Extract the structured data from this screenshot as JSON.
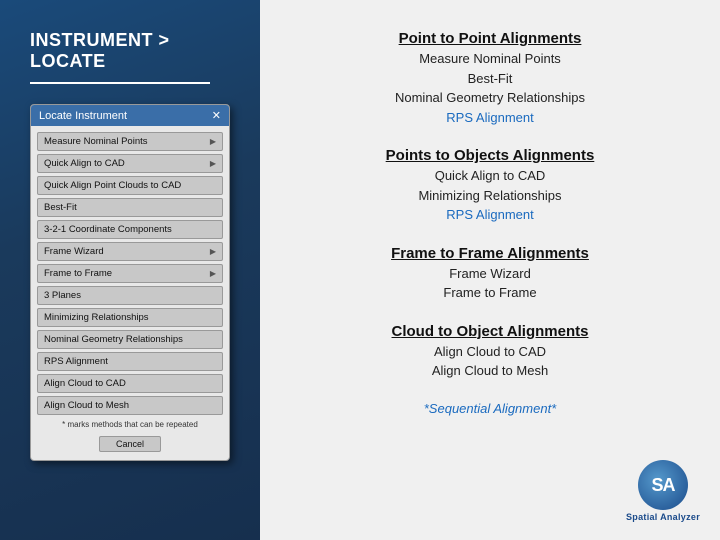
{
  "left": {
    "title": "INSTRUMENT > LOCATE",
    "dialog": {
      "title": "Locate Instrument",
      "buttons": [
        {
          "label": "Measure Nominal Points",
          "arrow": true
        },
        {
          "label": "Quick Align to CAD",
          "arrow": true
        },
        {
          "label": "Quick Align Point Clouds to CAD",
          "arrow": false
        },
        {
          "label": "Best-Fit",
          "arrow": false
        },
        {
          "label": "3-2-1 Coordinate Components",
          "arrow": false
        },
        {
          "label": "Frame Wizard",
          "arrow": true
        },
        {
          "label": "Frame to Frame",
          "arrow": true
        },
        {
          "label": "3 Planes",
          "arrow": false
        },
        {
          "label": "Minimizing Relationships",
          "arrow": false
        },
        {
          "label": "Nominal Geometry Relationships",
          "arrow": false
        },
        {
          "label": "RPS Alignment",
          "arrow": false
        },
        {
          "label": "Align Cloud to CAD",
          "arrow": false
        },
        {
          "label": "Align Cloud to Mesh",
          "arrow": false
        }
      ],
      "footer": "* marks methods that can be repeated",
      "cancel": "Cancel"
    }
  },
  "right": {
    "sections": [
      {
        "heading": "Point to Point Alignments",
        "items": [
          "Measure Nominal Points",
          "Best-Fit",
          "Nominal Geometry Relationships"
        ],
        "highlight": "RPS Alignment"
      },
      {
        "heading": "Points to Objects Alignments",
        "items": [
          "Quick Align to CAD",
          "Minimizing Relationships"
        ],
        "highlight": "RPS Alignment"
      },
      {
        "heading": "Frame to Frame Alignments",
        "items": [
          "Frame Wizard",
          "Frame to Frame"
        ],
        "highlight": null
      },
      {
        "heading": "Cloud to Object Alignments",
        "items": [
          "Align Cloud to CAD",
          "Align Cloud to Mesh"
        ],
        "highlight": null
      }
    ],
    "sequential": "*Sequential Alignment*",
    "logo": {
      "text": "SA",
      "subtext": "Spatial Analyzer"
    }
  }
}
